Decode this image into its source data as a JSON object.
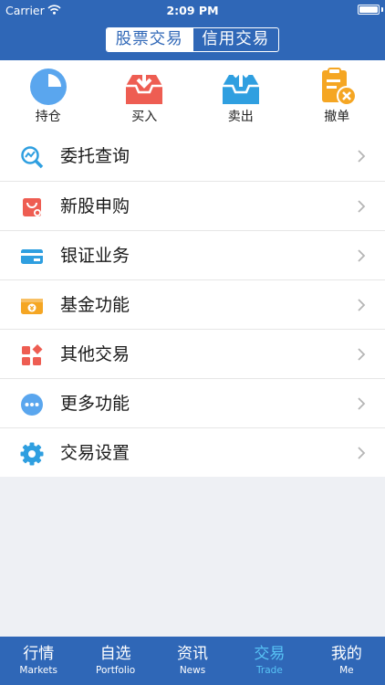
{
  "status_bar": {
    "carrier": "Carrier",
    "time": "2:09 PM"
  },
  "header": {
    "segments": [
      "股票交易",
      "信用交易"
    ],
    "active_segment": 0
  },
  "quick_actions": [
    {
      "label": "持仓",
      "icon": "pie-chart-icon",
      "color": "#5aa6ee"
    },
    {
      "label": "买入",
      "icon": "inbox-download-icon",
      "color": "#ee5d52"
    },
    {
      "label": "卖出",
      "icon": "inbox-upload-icon",
      "color": "#2f9fe0"
    },
    {
      "label": "撤单",
      "icon": "clipboard-cancel-icon",
      "color": "#f5a623"
    }
  ],
  "menu": [
    {
      "label": "委托查询",
      "icon": "magnifier-chart-icon"
    },
    {
      "label": "新股申购",
      "icon": "shopping-bag-icon"
    },
    {
      "label": "银证业务",
      "icon": "bank-card-icon"
    },
    {
      "label": "基金功能",
      "icon": "fund-wallet-icon"
    },
    {
      "label": "其他交易",
      "icon": "grid-diamond-icon"
    },
    {
      "label": "更多功能",
      "icon": "more-dots-icon"
    },
    {
      "label": "交易设置",
      "icon": "gear-icon"
    }
  ],
  "tabs": [
    {
      "cn": "行情",
      "en": "Markets"
    },
    {
      "cn": "自选",
      "en": "Portfolio"
    },
    {
      "cn": "资讯",
      "en": "News"
    },
    {
      "cn": "交易",
      "en": "Trade"
    },
    {
      "cn": "我的",
      "en": "Me"
    }
  ],
  "active_tab": 3,
  "colors": {
    "brand": "#2f67b7",
    "active_tab": "#58c3f5",
    "background": "#eef0f4"
  }
}
